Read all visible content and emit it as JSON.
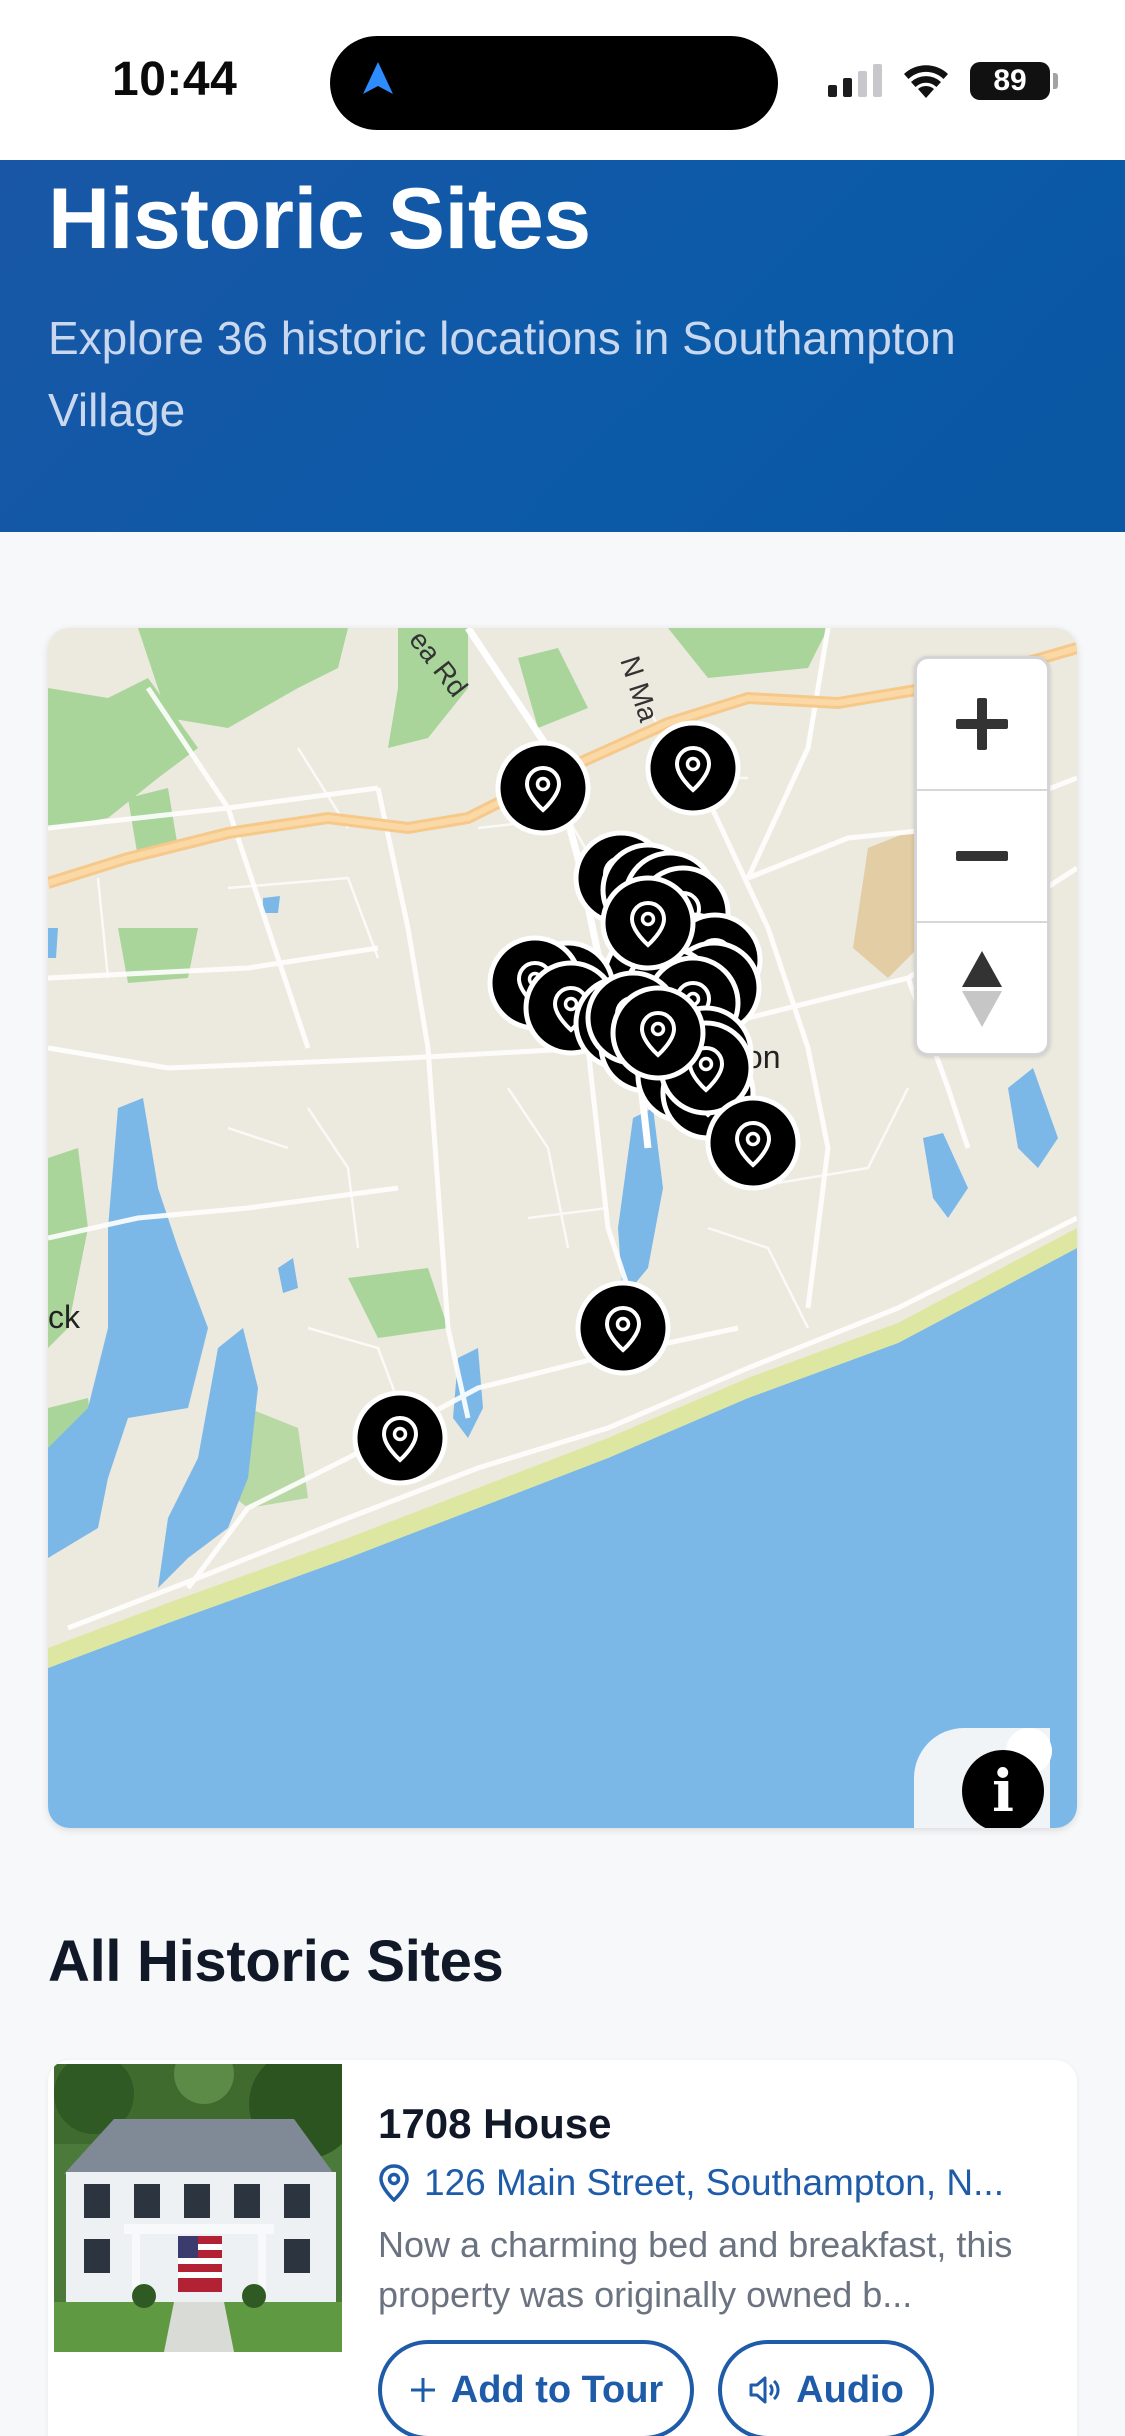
{
  "status_bar": {
    "time": "10:44",
    "battery": "89"
  },
  "hero": {
    "title": "Historic Sites",
    "subtitle": "Explore 36 historic locations in Southampton Village"
  },
  "map": {
    "labels": {
      "road_1": "ea Rd",
      "road_2": "N Ma",
      "town": "ton",
      "west": "ck"
    },
    "controls": {
      "zoom_in": "+",
      "zoom_out": "−",
      "info": "i"
    },
    "pin_count_visible": 20
  },
  "sites_section": {
    "title": "All Historic Sites",
    "items": [
      {
        "name": "1708 House",
        "address": "126 Main Street, Southampton, N...",
        "description": "Now a charming bed and breakfast, this property was originally owned b...",
        "add_to_tour_label": "Add to Tour",
        "audio_label": "Audio"
      }
    ]
  },
  "colors": {
    "brand_blue": "#0b5aa8",
    "accent_blue": "#1e5ba8",
    "water": "#7bb8e8",
    "land": "#ece9df",
    "park": "#a9d59b",
    "major_road": "#f6c889"
  }
}
